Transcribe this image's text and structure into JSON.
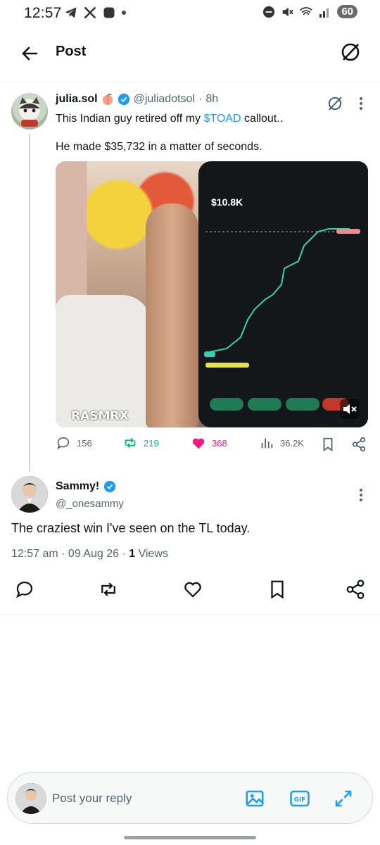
{
  "status": {
    "time": "12:57",
    "battery": "60"
  },
  "header": {
    "title": "Post"
  },
  "parent_post": {
    "name": "julia.sol",
    "handle": "@juliadotsol",
    "time": "8h",
    "text_before": "This Indian guy retired off my ",
    "cashtag": "$TOAD",
    "text_after": " callout..",
    "text2": "He made $35,732 in a matter of seconds.",
    "media": {
      "phone_value": "$10.8K",
      "watermark": "RASMRX"
    },
    "stats": {
      "replies": "156",
      "reposts": "219",
      "likes": "368",
      "views": "36.2K"
    }
  },
  "main_post": {
    "name": "Sammy!",
    "handle": "@_onesammy",
    "text": "The craziest win I've seen on the TL today.",
    "meta_time": "12:57 am · 09 Aug 26 · ",
    "views_count": "1",
    "views_label": " Views"
  },
  "reply": {
    "placeholder": "Post your reply"
  },
  "colors": {
    "accent": "#1d9bf0",
    "like": "#f91880",
    "repost": "#00ba7c",
    "muted": "#536471"
  }
}
